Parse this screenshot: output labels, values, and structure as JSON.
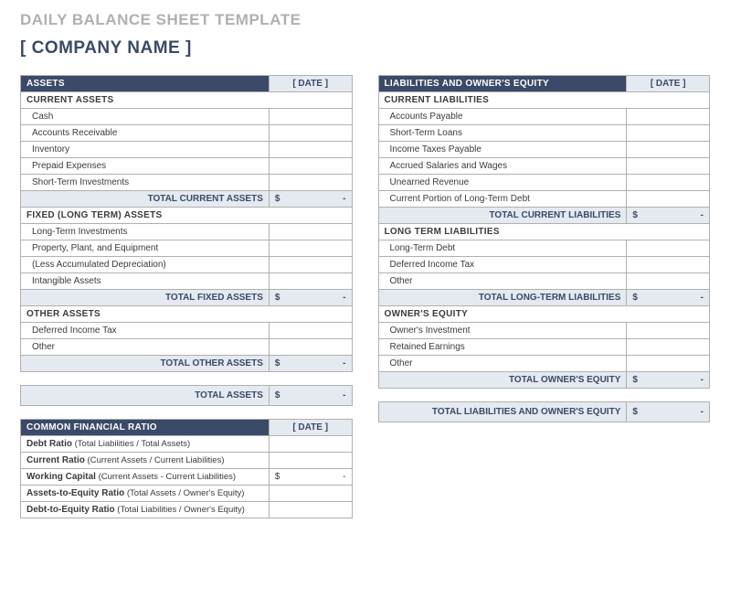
{
  "doc_title": "DAILY BALANCE SHEET TEMPLATE",
  "company": "[ COMPANY NAME ]",
  "assets": {
    "header": "ASSETS",
    "date": "[ DATE ]",
    "current": {
      "title": "CURRENT ASSETS",
      "items": [
        "Cash",
        "Accounts Receivable",
        "Inventory",
        "Prepaid Expenses",
        "Short-Term Investments"
      ],
      "total_label": "TOTAL CURRENT ASSETS",
      "total_currency": "$",
      "total_dash": "-"
    },
    "fixed": {
      "title": "FIXED (LONG TERM) ASSETS",
      "items": [
        "Long-Term Investments",
        "Property, Plant, and Equipment",
        "(Less Accumulated Depreciation)",
        "Intangible Assets"
      ],
      "total_label": "TOTAL FIXED ASSETS",
      "total_currency": "$",
      "total_dash": "-"
    },
    "other": {
      "title": "OTHER ASSETS",
      "items": [
        "Deferred Income Tax",
        "Other"
      ],
      "total_label": "TOTAL OTHER ASSETS",
      "total_currency": "$",
      "total_dash": "-"
    },
    "grand_label": "TOTAL ASSETS",
    "grand_currency": "$",
    "grand_dash": "-"
  },
  "liab": {
    "header": "LIABILITIES AND OWNER'S EQUITY",
    "date": "[ DATE ]",
    "current": {
      "title": "CURRENT LIABILITIES",
      "items": [
        "Accounts Payable",
        "Short-Term Loans",
        "Income Taxes Payable",
        "Accrued Salaries and Wages",
        "Unearned Revenue",
        "Current Portion of Long-Term Debt"
      ],
      "total_label": "TOTAL CURRENT LIABILITIES",
      "total_currency": "$",
      "total_dash": "-"
    },
    "long": {
      "title": "LONG TERM LIABILITIES",
      "items": [
        "Long-Term Debt",
        "Deferred Income Tax",
        "Other"
      ],
      "total_label": "TOTAL LONG-TERM LIABILITIES",
      "total_currency": "$",
      "total_dash": "-"
    },
    "equity": {
      "title": "OWNER'S EQUITY",
      "items": [
        "Owner's Investment",
        "Retained Earnings",
        "Other"
      ],
      "total_label": "TOTAL OWNER'S EQUITY",
      "total_currency": "$",
      "total_dash": "-"
    },
    "grand_label": "TOTAL LIABILITIES AND OWNER'S EQUITY",
    "grand_currency": "$",
    "grand_dash": "-"
  },
  "ratio": {
    "header": "COMMON FINANCIAL RATIO",
    "date": "[ DATE ]",
    "rows": [
      {
        "bold": "Debt Ratio",
        "hint": " (Total Liabilities / Total Assets)",
        "val": ""
      },
      {
        "bold": "Current Ratio",
        "hint": " (Current Assets / Current Liabilities)",
        "val": ""
      },
      {
        "bold": "Working Capital",
        "hint": " (Current Assets - Current Liabilities)",
        "val": "$",
        "dash": "-"
      },
      {
        "bold": "Assets-to-Equity Ratio",
        "hint": " (Total Assets / Owner's Equity)",
        "val": ""
      },
      {
        "bold": "Debt-to-Equity Ratio",
        "hint": " (Total Liabilities / Owner's Equity)",
        "val": ""
      }
    ]
  }
}
